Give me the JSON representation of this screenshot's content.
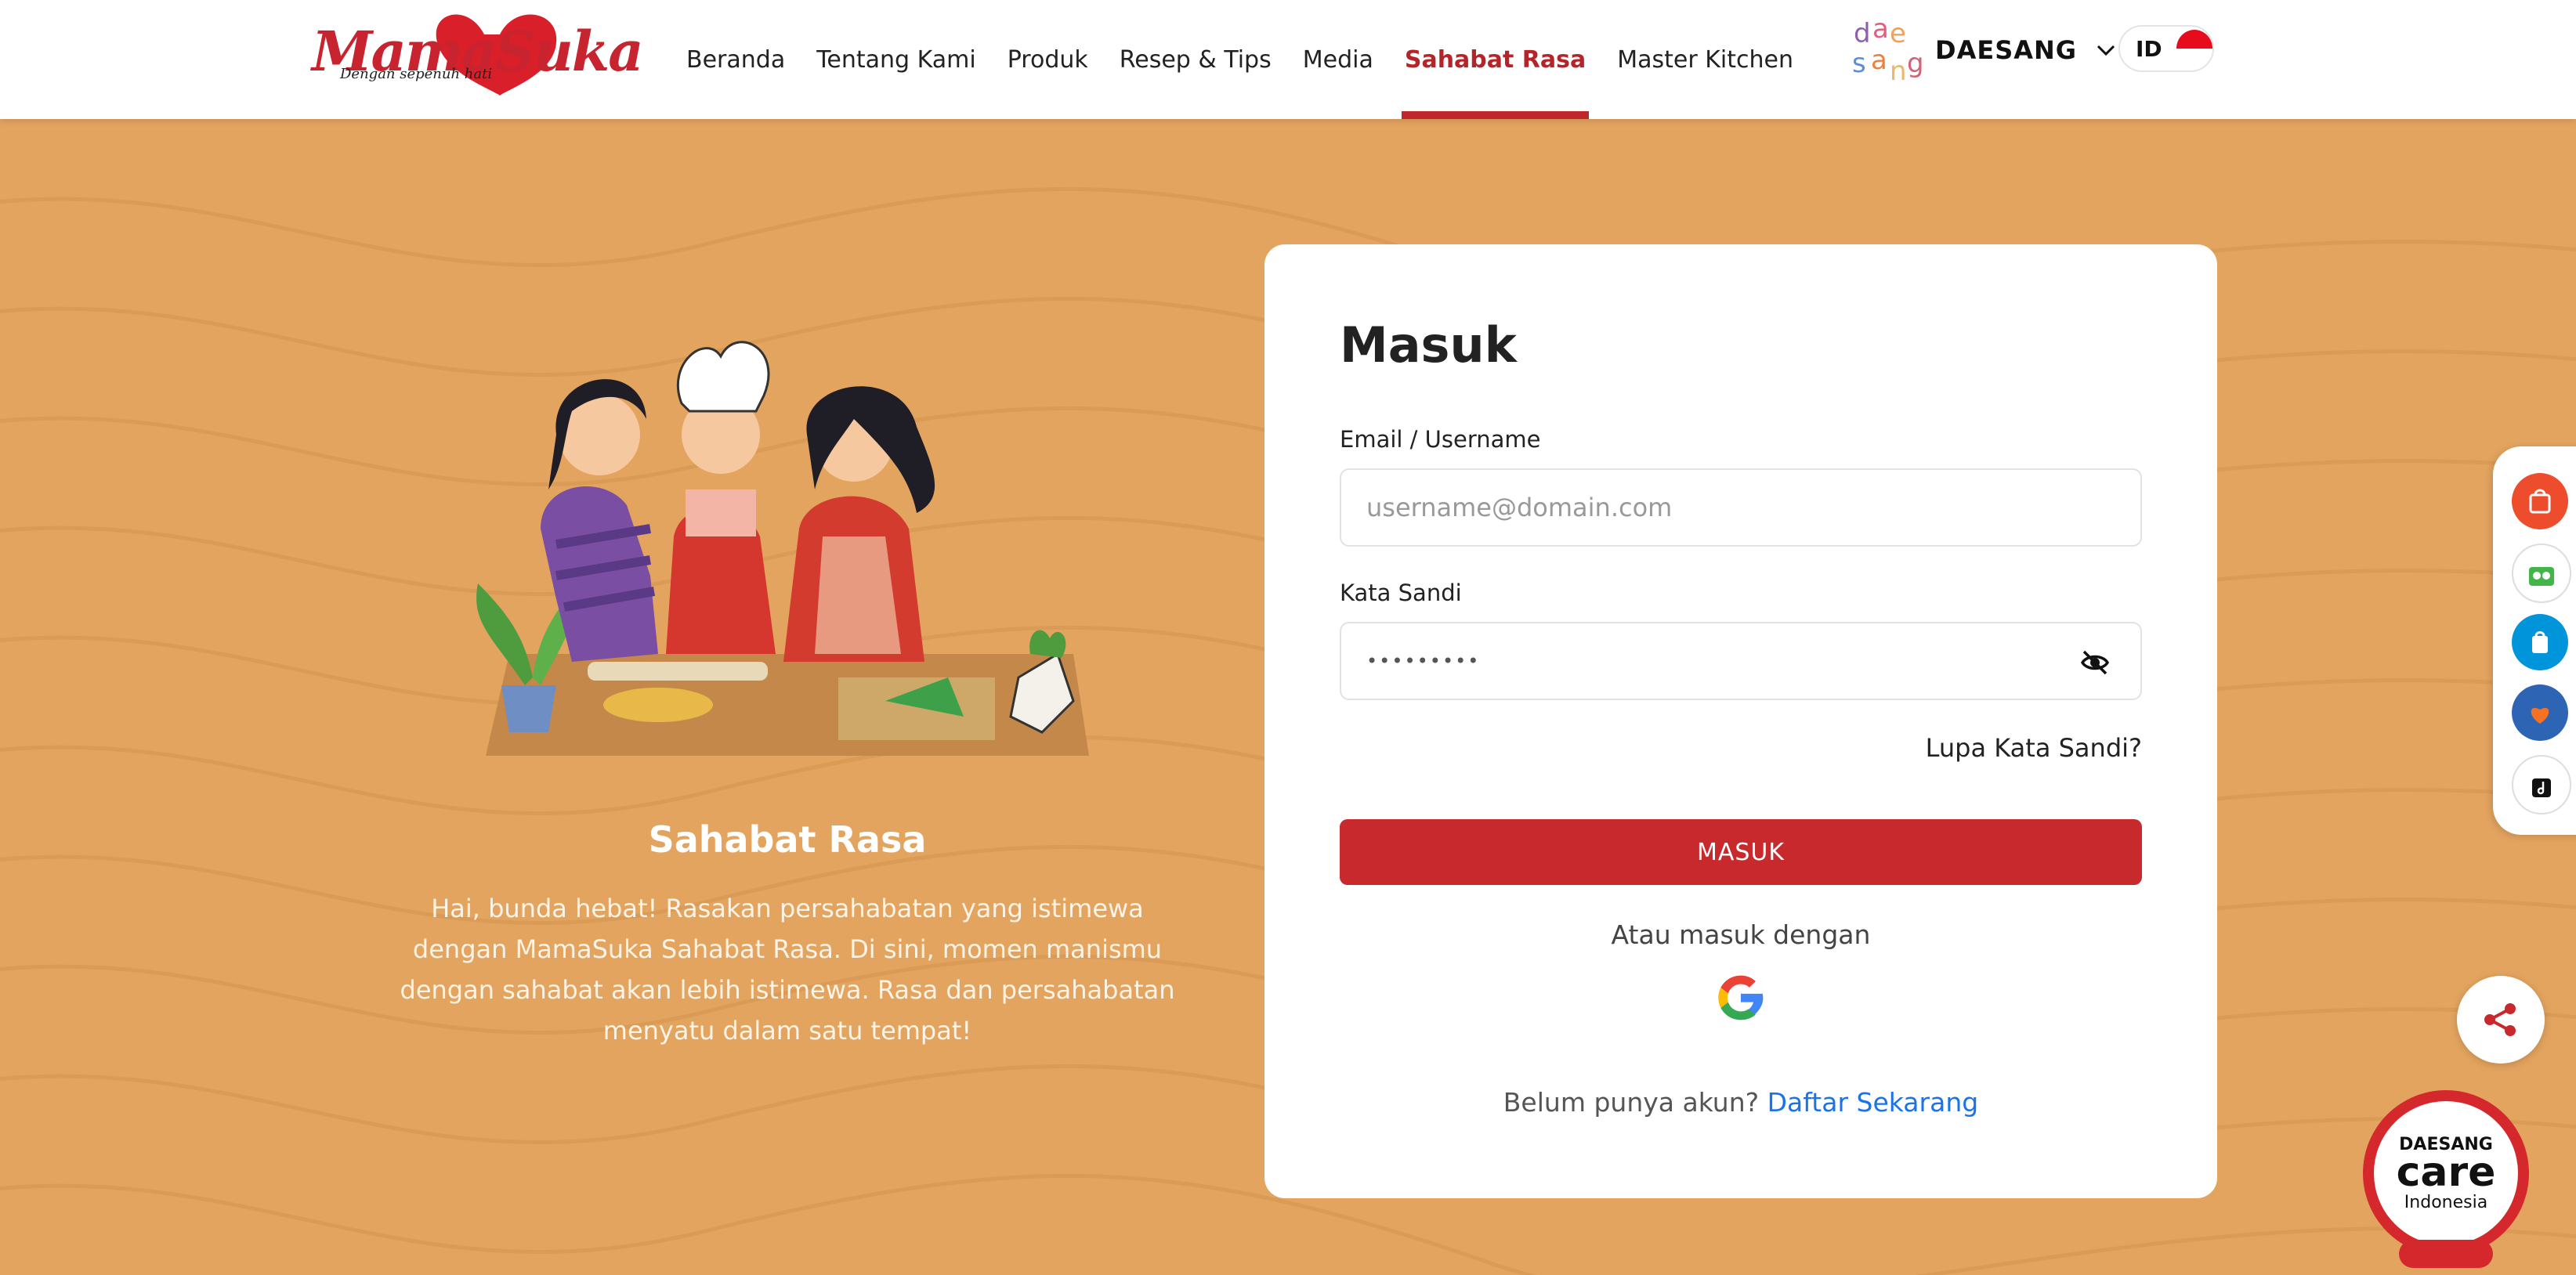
{
  "header": {
    "logo": {
      "brand": "MamaSuka",
      "tagline": "Dengan sepenuh hati"
    },
    "nav": [
      {
        "label": "Beranda",
        "active": false
      },
      {
        "label": "Tentang Kami",
        "active": false
      },
      {
        "label": "Produk",
        "active": false
      },
      {
        "label": "Resep & Tips",
        "active": false
      },
      {
        "label": "Media",
        "active": false
      },
      {
        "label": "Sahabat Rasa",
        "active": true
      },
      {
        "label": "Master Kitchen",
        "active": false
      }
    ],
    "company": "DAESANG",
    "language": "ID"
  },
  "intro": {
    "title": "Sahabat Rasa",
    "description": "Hai, bunda hebat! Rasakan persahabatan yang istimewa dengan MamaSuka Sahabat Rasa. Di sini, momen manismu dengan sahabat akan lebih istimewa. Rasa dan persahabatan menyatu dalam satu tempat!"
  },
  "login": {
    "title": "Masuk",
    "email_label": "Email / Username",
    "email_placeholder": "username@domain.com",
    "password_label": "Kata Sandi",
    "password_value": "•••••••••",
    "forgot": "Lupa Kata Sandi?",
    "submit": "MASUK",
    "or_text": "Atau masuk dengan",
    "signup_prompt": "Belum punya akun?",
    "signup_link": "Daftar Sekarang"
  },
  "floating": {
    "marketplaces": [
      "shopee-icon",
      "tokopedia-icon",
      "blibli-icon",
      "lazada-icon",
      "tiktok-shop-icon"
    ],
    "share": "share-icon",
    "care": {
      "line1": "DAESANG",
      "line2": "care",
      "line3": "Indonesia"
    }
  },
  "colors": {
    "accent": "#c8292c",
    "background": "#e3a45f",
    "link": "#1a73e8"
  }
}
